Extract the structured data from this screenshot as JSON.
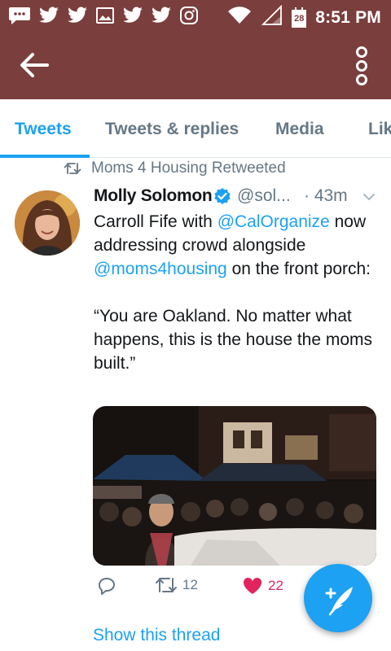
{
  "status_bar": {
    "time": "8:51 PM",
    "calendar_day": "28",
    "icons": [
      "chat-bubble-icon",
      "twitter-bird-icon",
      "twitter-bird-icon",
      "image-icon",
      "twitter-bird-icon",
      "twitter-bird-icon",
      "instagram-icon",
      "wifi-icon",
      "signal-icon",
      "calendar-icon"
    ]
  },
  "app_bar": {
    "back_icon": "arrow-left-icon",
    "menu_icon": "more-vertical-icon"
  },
  "tabs": [
    {
      "label": "Tweets",
      "active": true
    },
    {
      "label": "Tweets & replies",
      "active": false
    },
    {
      "label": "Media",
      "active": false
    },
    {
      "label": "Lik",
      "active": false
    }
  ],
  "tweet": {
    "retweet_label": "Moms 4 Housing Retweeted",
    "author_name": "Molly Solomon",
    "handle": "@sol...",
    "time": "· 43m",
    "body_parts": {
      "p1": "Carroll Fife with ",
      "m1": "@CalOrganize",
      "p2": " now addressing crowd alongside ",
      "m2": "@moms4housing",
      "p3": " on the front porch:",
      "quote": "“You are Oakland. No matter what happens, this is the house the moms built.”"
    },
    "reply_count": "",
    "retweet_count": "12",
    "like_count": "22",
    "liked": true,
    "show_thread": "Show this thread"
  },
  "colors": {
    "app_bar": "#7a3e3c",
    "accent": "#1da1f2",
    "like": "#e0245e",
    "muted": "#657786"
  },
  "fab_icon": "compose-tweet-icon"
}
